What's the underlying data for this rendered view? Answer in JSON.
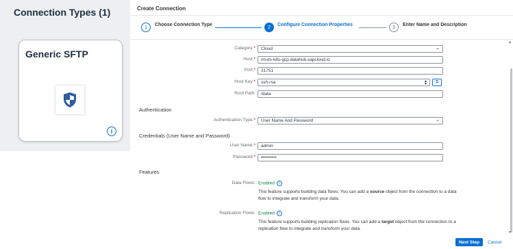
{
  "left_panel": {
    "title": "Connection Types (1)",
    "tile": {
      "title": "Generic SFTP",
      "logo_icon": "shield-icon",
      "info_icon": "info-icon"
    }
  },
  "dialog": {
    "header": "Create Connection",
    "steps": [
      {
        "number": "1",
        "label": "Choose Connection Type",
        "state": "done"
      },
      {
        "number": "2",
        "label": "Configure Connection Properties",
        "state": "active"
      },
      {
        "number": "3",
        "label": "Enter Name and Description",
        "state": "pending"
      }
    ],
    "connection_details": {
      "category": {
        "label": "Category:",
        "value": "Cloud"
      },
      "host": {
        "label": "Host:",
        "value": "im-ds-k8s-gcp.datahub.sapcloud.io"
      },
      "port": {
        "label": "Port:",
        "value": "31751"
      },
      "host_key": {
        "label": "Host Key:",
        "value": "ssh-rsa"
      },
      "root_path": {
        "label": "Root Path:",
        "value": "/data"
      }
    },
    "authentication": {
      "heading": "Authentication",
      "type": {
        "label": "Authentication Type:",
        "value": "User Name And Password"
      }
    },
    "credentials": {
      "heading": "Credentials (User Name and Password)",
      "user_name": {
        "label": "User Name:",
        "value": "admin"
      },
      "password": {
        "label": "Password:",
        "value": "••••••••••"
      }
    },
    "features": {
      "heading": "Features",
      "data_flows": {
        "label": "Data Flows:",
        "status": "Enabled",
        "desc_pre": "This feature supports building data flows. You can add a ",
        "desc_bold": "source",
        "desc_post": " object from the connection to a data flow to integrate and transform your data."
      },
      "replication_flows": {
        "label": "Replication Flows:",
        "status": "Enabled",
        "desc_pre": "This feature supports building replication flows. You can add a ",
        "desc_bold": "target",
        "desc_post": " object from the connection to a replication flow to integrate and transform your data."
      }
    },
    "footer": {
      "next_label": "Next Step",
      "cancel_label": "Cancel"
    }
  },
  "colors": {
    "accent": "#0a6ed1",
    "success": "#107e3e",
    "required": "#bb0000"
  }
}
